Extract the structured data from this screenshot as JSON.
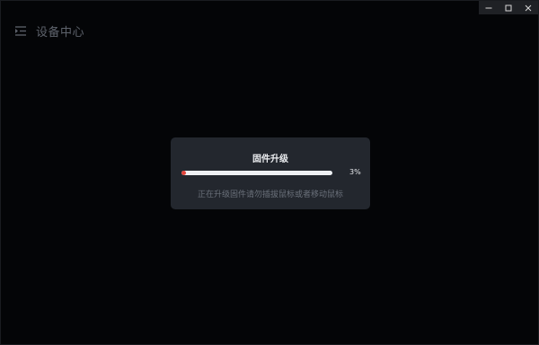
{
  "window": {
    "controls": {
      "minimize": "—",
      "maximize": "□",
      "close": "✕"
    }
  },
  "header": {
    "menu_icon": "menu-collapse-icon",
    "title": "设备中心"
  },
  "dialog": {
    "title": "固件升级",
    "progress": {
      "value": 3,
      "label": "3%"
    },
    "message": "正在升级固件请勿插拔鼠标或者移动鼠标"
  },
  "colors": {
    "background": "#040507",
    "dialog_background": "#23272e",
    "progress_fill": "#e2433a",
    "progress_track": "#eef0f3",
    "header_text": "#5e636c",
    "message_text": "#6b717b"
  }
}
